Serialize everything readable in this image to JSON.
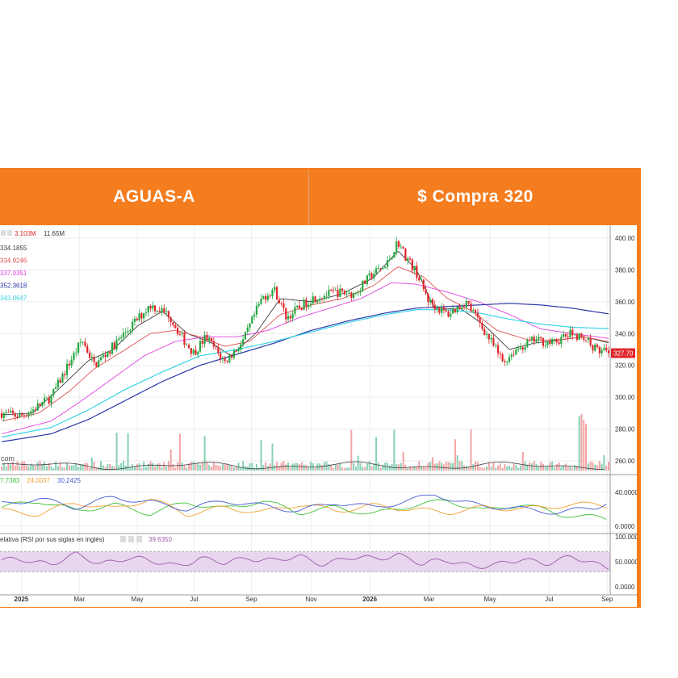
{
  "header": {
    "left_title": "AGUAS-A",
    "right_title": "$ Compra 320"
  },
  "colors": {
    "frame": "#f47d20",
    "candle_up": "#26a641",
    "candle_down": "#e0262b",
    "volume_up": "#88d0b4",
    "volume_down": "#f2a4a4",
    "price_tag": "#e0262b",
    "rsi_band": "#e7d6ee",
    "rsi_line": "#9c5aa8"
  },
  "chart_data": [
    {
      "type": "candlestick",
      "panel": "price",
      "legend_volume": [
        "3.103M",
        "11.65M"
      ],
      "price_scale": [
        260,
        400
      ],
      "y_ticks": [
        "400.00",
        "380.00",
        "360.00",
        "340.00",
        "320.00",
        "300.00",
        "280.00",
        "260.00"
      ],
      "last_price_label": "327.70",
      "moving_averages": [
        {
          "label": "334.1855",
          "color": "#3d3d3d"
        },
        {
          "label": "334.9246",
          "color": "#e05050"
        },
        {
          "label": "337.0351",
          "color": "#e040e0"
        },
        {
          "label": "352.3618",
          "color": "#2c35a8"
        },
        {
          "label": "343.0647",
          "color": "#36d4e8"
        }
      ],
      "volume_watermark": "com",
      "price_anchors": [
        [
          0,
          290
        ],
        [
          3,
          288
        ],
        [
          5,
          292
        ],
        [
          8,
          300
        ],
        [
          11,
          322
        ],
        [
          13,
          336
        ],
        [
          15,
          320
        ],
        [
          18,
          332
        ],
        [
          21,
          345
        ],
        [
          24,
          358
        ],
        [
          27,
          352
        ],
        [
          29,
          338
        ],
        [
          31,
          328
        ],
        [
          33,
          338
        ],
        [
          36,
          322
        ],
        [
          39,
          335
        ],
        [
          42,
          362
        ],
        [
          44,
          368
        ],
        [
          46,
          350
        ],
        [
          50,
          362
        ],
        [
          54,
          366
        ],
        [
          57,
          365
        ],
        [
          60,
          378
        ],
        [
          62,
          382
        ],
        [
          64,
          398
        ],
        [
          65,
          390
        ],
        [
          67,
          378
        ],
        [
          69,
          360
        ],
        [
          72,
          352
        ],
        [
          75,
          360
        ],
        [
          77,
          348
        ],
        [
          79,
          335
        ],
        [
          81,
          322
        ],
        [
          83,
          330
        ],
        [
          86,
          336
        ],
        [
          89,
          334
        ],
        [
          92,
          340
        ],
        [
          94,
          338
        ],
        [
          96,
          330
        ],
        [
          98,
          327.7
        ]
      ],
      "ma_anchors": [
        [
          [
            0,
            289
          ],
          [
            5,
            290
          ],
          [
            10,
            308
          ],
          [
            14,
            323
          ],
          [
            18,
            330
          ],
          [
            22,
            345
          ],
          [
            26,
            354
          ],
          [
            30,
            340
          ],
          [
            34,
            334
          ],
          [
            37,
            326
          ],
          [
            41,
            340
          ],
          [
            45,
            362
          ],
          [
            50,
            360
          ],
          [
            55,
            365
          ],
          [
            60,
            375
          ],
          [
            64,
            392
          ],
          [
            67,
            380
          ],
          [
            70,
            355
          ],
          [
            74,
            356
          ],
          [
            78,
            345
          ],
          [
            82,
            330
          ],
          [
            86,
            334
          ],
          [
            90,
            336
          ],
          [
            94,
            338
          ],
          [
            98,
            334.2
          ]
        ],
        [
          [
            0,
            285
          ],
          [
            6,
            290
          ],
          [
            11,
            304
          ],
          [
            15,
            318
          ],
          [
            20,
            330
          ],
          [
            24,
            340
          ],
          [
            28,
            342
          ],
          [
            32,
            338
          ],
          [
            36,
            332
          ],
          [
            40,
            335
          ],
          [
            45,
            352
          ],
          [
            50,
            358
          ],
          [
            55,
            362
          ],
          [
            60,
            370
          ],
          [
            64,
            382
          ],
          [
            68,
            376
          ],
          [
            72,
            362
          ],
          [
            76,
            354
          ],
          [
            80,
            342
          ],
          [
            85,
            336
          ],
          [
            90,
            336
          ],
          [
            94,
            338
          ],
          [
            98,
            334.9
          ]
        ],
        [
          [
            0,
            277
          ],
          [
            8,
            285
          ],
          [
            13,
            298
          ],
          [
            18,
            312
          ],
          [
            23,
            326
          ],
          [
            28,
            335
          ],
          [
            33,
            338
          ],
          [
            38,
            338
          ],
          [
            43,
            342
          ],
          [
            48,
            350
          ],
          [
            53,
            356
          ],
          [
            58,
            362
          ],
          [
            63,
            372
          ],
          [
            67,
            371
          ],
          [
            72,
            366
          ],
          [
            77,
            360
          ],
          [
            82,
            352
          ],
          [
            87,
            343
          ],
          [
            92,
            340
          ],
          [
            98,
            337.0
          ]
        ],
        [
          [
            0,
            272
          ],
          [
            8,
            277
          ],
          [
            14,
            286
          ],
          [
            20,
            298
          ],
          [
            26,
            310
          ],
          [
            32,
            320
          ],
          [
            38,
            327
          ],
          [
            44,
            334
          ],
          [
            50,
            342
          ],
          [
            56,
            348
          ],
          [
            62,
            353
          ],
          [
            67,
            356
          ],
          [
            72,
            357
          ],
          [
            77,
            358
          ],
          [
            82,
            359
          ],
          [
            87,
            358
          ],
          [
            92,
            356
          ],
          [
            98,
            352.4
          ]
        ],
        [
          [
            0,
            275
          ],
          [
            8,
            281
          ],
          [
            14,
            292
          ],
          [
            20,
            305
          ],
          [
            26,
            316
          ],
          [
            32,
            326
          ],
          [
            38,
            330
          ],
          [
            44,
            335
          ],
          [
            50,
            341
          ],
          [
            56,
            347
          ],
          [
            62,
            352
          ],
          [
            67,
            355
          ],
          [
            72,
            355
          ],
          [
            77,
            353
          ],
          [
            82,
            349
          ],
          [
            87,
            346
          ],
          [
            92,
            344
          ],
          [
            98,
            343.1
          ]
        ]
      ]
    },
    {
      "type": "line",
      "panel": "dmi",
      "legend": [
        {
          "label": "7.7383",
          "color": "#3fc23a"
        },
        {
          "label": "24.0037",
          "color": "#f0a030"
        },
        {
          "label": "30.2425",
          "color": "#4a5ad0"
        }
      ],
      "y_ticks": [
        "40.0000",
        "0.0000"
      ],
      "y_range": [
        -5,
        55
      ],
      "series": [
        {
          "color": "#3fc23a",
          "anchors": [
            [
              0,
              22
            ],
            [
              6,
              30
            ],
            [
              12,
              18
            ],
            [
              18,
              25
            ],
            [
              24,
              15
            ],
            [
              30,
              28
            ],
            [
              36,
              20
            ],
            [
              42,
              30
            ],
            [
              48,
              16
            ],
            [
              54,
              22
            ],
            [
              60,
              14
            ],
            [
              66,
              24
            ],
            [
              72,
              30
            ],
            [
              78,
              18
            ],
            [
              84,
              26
            ],
            [
              90,
              14
            ],
            [
              96,
              10
            ],
            [
              98,
              8
            ]
          ]
        },
        {
          "color": "#f0a030",
          "anchors": [
            [
              0,
              18
            ],
            [
              6,
              14
            ],
            [
              12,
              28
            ],
            [
              18,
              20
            ],
            [
              24,
              32
            ],
            [
              30,
              14
            ],
            [
              36,
              22
            ],
            [
              42,
              16
            ],
            [
              48,
              26
            ],
            [
              54,
              18
            ],
            [
              60,
              24
            ],
            [
              66,
              20
            ],
            [
              72,
              16
            ],
            [
              78,
              22
            ],
            [
              84,
              20
            ],
            [
              90,
              24
            ],
            [
              96,
              26
            ],
            [
              98,
              24
            ]
          ]
        },
        {
          "color": "#4a5ad0",
          "anchors": [
            [
              0,
              26
            ],
            [
              6,
              32
            ],
            [
              12,
              22
            ],
            [
              18,
              34
            ],
            [
              24,
              28
            ],
            [
              30,
              20
            ],
            [
              36,
              30
            ],
            [
              42,
              24
            ],
            [
              48,
              18
            ],
            [
              54,
              28
            ],
            [
              60,
              22
            ],
            [
              66,
              30
            ],
            [
              70,
              38
            ],
            [
              74,
              28
            ],
            [
              78,
              24
            ],
            [
              84,
              20
            ],
            [
              90,
              16
            ],
            [
              96,
              22
            ],
            [
              98,
              30
            ]
          ]
        }
      ]
    },
    {
      "type": "line",
      "panel": "rsi",
      "legend_label": "elativa (RSI por sus siglas en inglés)",
      "legend_value": "39.6350",
      "y_ticks": [
        "100.000",
        "50.0000",
        "0.0000"
      ],
      "band": [
        30,
        70
      ],
      "anchors": [
        [
          0,
          50
        ],
        [
          4,
          56
        ],
        [
          8,
          46
        ],
        [
          12,
          62
        ],
        [
          16,
          48
        ],
        [
          20,
          58
        ],
        [
          24,
          50
        ],
        [
          28,
          44
        ],
        [
          32,
          56
        ],
        [
          36,
          46
        ],
        [
          40,
          60
        ],
        [
          44,
          52
        ],
        [
          48,
          58
        ],
        [
          52,
          48
        ],
        [
          56,
          58
        ],
        [
          60,
          54
        ],
        [
          64,
          66
        ],
        [
          66,
          58
        ],
        [
          68,
          44
        ],
        [
          72,
          52
        ],
        [
          76,
          44
        ],
        [
          80,
          42
        ],
        [
          84,
          54
        ],
        [
          88,
          50
        ],
        [
          92,
          58
        ],
        [
          96,
          44
        ],
        [
          98,
          40
        ]
      ]
    }
  ],
  "x_axis": {
    "labels": [
      {
        "text": "2025",
        "pos": 0.035,
        "bold": true
      },
      {
        "text": "Mar",
        "pos": 0.13
      },
      {
        "text": "May",
        "pos": 0.225
      },
      {
        "text": "Jul",
        "pos": 0.318
      },
      {
        "text": "Sep",
        "pos": 0.412
      },
      {
        "text": "Nov",
        "pos": 0.51
      },
      {
        "text": "2026",
        "pos": 0.606,
        "bold": true
      },
      {
        "text": "Mar",
        "pos": 0.703
      },
      {
        "text": "May",
        "pos": 0.803
      },
      {
        "text": "Jul",
        "pos": 0.9
      },
      {
        "text": "Sep",
        "pos": 0.995
      }
    ]
  }
}
